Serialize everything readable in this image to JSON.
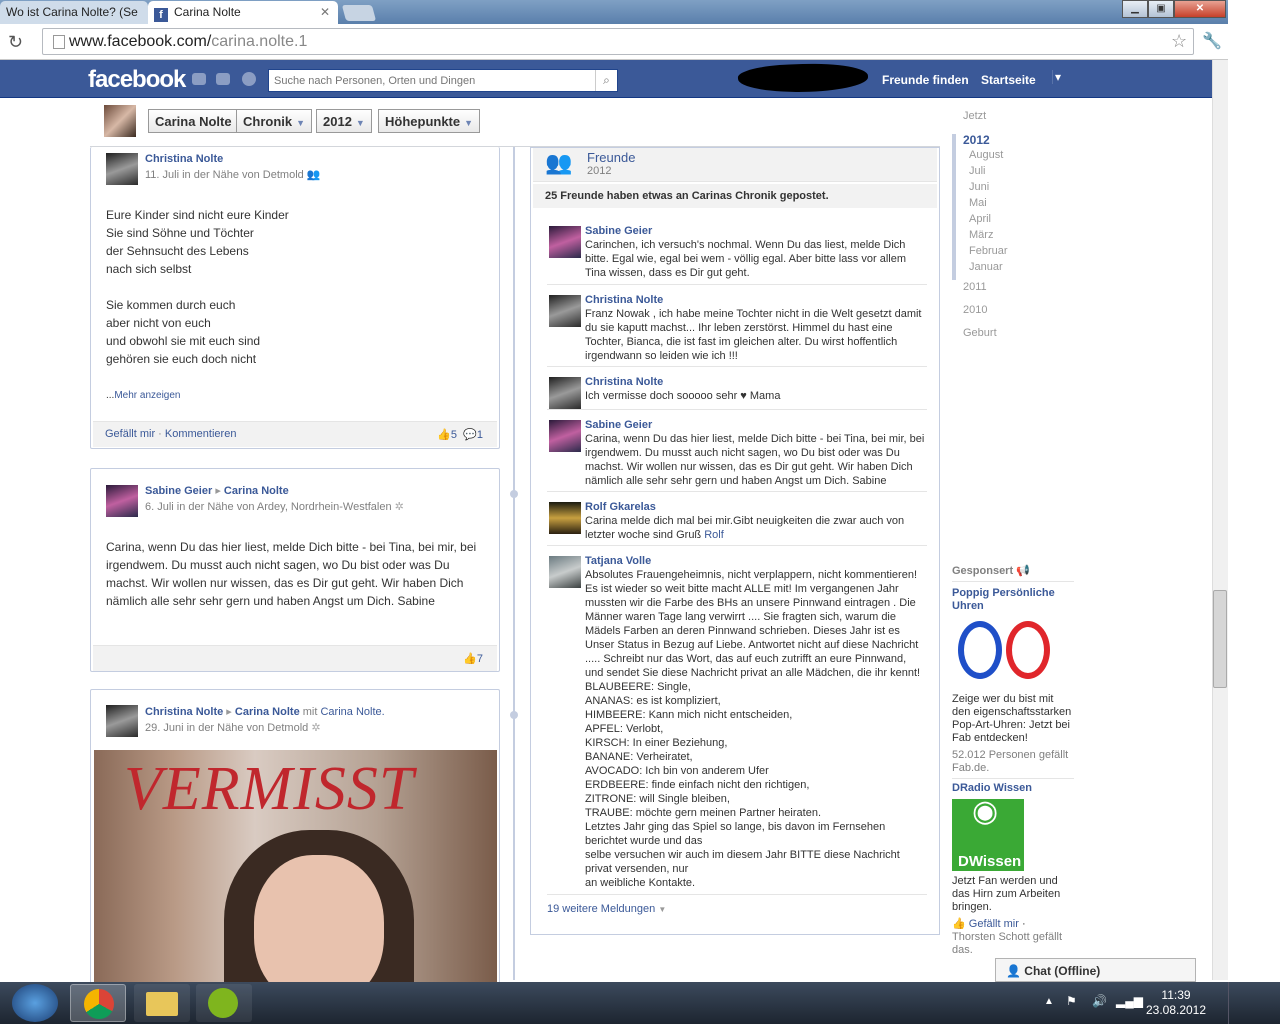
{
  "browser": {
    "tabs": [
      {
        "title": "Wo ist Carina Nolte? (Se"
      },
      {
        "title": "Carina Nolte"
      }
    ],
    "url_host": "www.facebook.com/",
    "url_path": "carina.nolte.1"
  },
  "fb_header": {
    "logo": "facebook",
    "search_placeholder": "Suche nach Personen, Orten und Dingen",
    "find_friends": "Freunde finden",
    "home": "Startseite"
  },
  "timeline_header": {
    "name": "Carina Nolte",
    "chronik": "Chronik",
    "year": "2012",
    "highlights": "Höhepunkte"
  },
  "stories": [
    {
      "author": "Christina Nolte",
      "meta": "11. Juli in der Nähe von Detmold",
      "lines": [
        "Eure Kinder sind nicht eure Kinder",
        "Sie sind Söhne und Töchter",
        "der Sehnsucht des Lebens",
        "nach sich selbst",
        "",
        "Sie kommen durch euch",
        "aber nicht von euch",
        "und obwohl sie mit euch sind",
        "gehören sie euch doch nicht"
      ],
      "more_prefix": "...",
      "more": "Mehr anzeigen",
      "like": "Gefällt mir",
      "comment": "Kommentieren",
      "likes": "5",
      "comments": "1"
    },
    {
      "author": "Sabine Geier",
      "target": "Carina Nolte",
      "meta": "6. Juli in der Nähe von Ardey, Nordrhein-Westfalen",
      "text": "Carina, wenn Du das hier liest, melde Dich bitte - bei Tina, bei mir, bei irgendwem. Du musst auch nicht sagen, wo Du bist oder was Du machst. Wir wollen nur wissen, das es Dir gut geht. Wir haben Dich nämlich alle sehr sehr gern und haben Angst um Dich. Sabine",
      "likes": "7"
    },
    {
      "author": "Christina Nolte",
      "target": "Carina Nolte",
      "with_prefix": "mit",
      "with": "Carina Nolte.",
      "meta": "29. Juni in der Nähe von Detmold",
      "image_caption": "VERMISST"
    }
  ],
  "friends_box": {
    "title": "Freunde",
    "year": "2012",
    "summary": "25 Freunde haben etwas an Carinas Chronik gepostet.",
    "posts": [
      {
        "name": "Sabine Geier",
        "text": "Carinchen, ich versuch's nochmal. Wenn Du das liest, melde Dich bitte. Egal wie, egal bei wem - völlig egal. Aber bitte lass vor allem Tina wissen, dass es Dir gut geht."
      },
      {
        "name": "Christina Nolte",
        "text": "Franz Nowak , ich habe meine Tochter nicht in die Welt gesetzt damit du sie kaputt machst... Ihr leben zerstörst. Himmel du hast eine Tochter, Bianca, die ist fast im gleichen alter. Du wirst hoffentlich irgendwann so leiden wie ich !!!"
      },
      {
        "name": "Christina Nolte",
        "text": "Ich vermisse doch sooooo sehr ♥ Mama"
      },
      {
        "name": "Sabine Geier",
        "text": "Carina, wenn Du das hier liest, melde Dich bitte - bei Tina, bei mir, bei irgendwem. Du musst auch nicht sagen, wo Du bist oder was Du machst. Wir wollen nur wissen, das es Dir gut geht. Wir haben Dich nämlich alle sehr sehr gern und haben Angst um Dich. Sabine"
      },
      {
        "name": "Rolf Gkarelas",
        "text": "Carina melde dich mal bei mir.Gibt neuigkeiten die zwar auch von letzter woche sind Gruß",
        "link": "Rolf"
      },
      {
        "name": "Tatjana Volle",
        "lines": [
          "Absolutes Frauengeheimnis, nicht verplappern, nicht kommentieren!",
          "Es ist wieder so weit bitte macht ALLE mit! Im vergangenen Jahr mussten wir die Farbe des BHs an unsere Pinnwand eintragen . Die Männer waren Tage lang verwirrt .... Sie fragten sich, warum die Mädels Farben an deren Pinnwand schrieben. Dieses Jahr ist es Unser Status in Bezug auf Liebe. Antwortet nicht auf diese Nachricht ..... Schreibt nur das Wort, das auf euch zutrifft an eure Pinnwand, und sendet Sie diese Nachricht privat an alle Mädchen, die ihr kennt!",
          "BLAUBEERE: Single,",
          "ANANAS: es ist kompliziert,",
          "HIMBEERE: Kann mich nicht entscheiden,",
          "APFEL: Verlobt,",
          "KIRSCH: In einer Beziehung,",
          "BANANE: Verheiratet,",
          "AVOCADO: Ich bin von anderem Ufer",
          "ERDBEERE: finde einfach nicht den richtigen,",
          "ZITRONE: will Single bleiben,",
          "TRAUBE: möchte gern meinen Partner heiraten.",
          "Letztes Jahr ging das Spiel so lange, bis davon im Fernsehen berichtet wurde und das",
          "selbe versuchen wir auch im diesem Jahr BITTE diese Nachricht privat versenden, nur",
          "an weibliche Kontakte."
        ]
      }
    ],
    "more": "19 weitere Meldungen"
  },
  "timeline_nav": {
    "now": "Jetzt",
    "year_current": "2012",
    "months": [
      "August",
      "Juli",
      "Juni",
      "Mai",
      "April",
      "März",
      "Februar",
      "Januar"
    ],
    "years": [
      "2011",
      "2010"
    ],
    "birth": "Geburt"
  },
  "sponsored": {
    "heading": "Gesponsert",
    "ad1_title": "Poppig Persönliche Uhren",
    "ad1_text": "Zeige wer du bist mit den eigenschaftsstarken Pop-Art-Uhren: Jetzt bei Fab entdecken!",
    "ad1_social": "52.012 Personen gefällt Fab.de.",
    "ad2_title": "DRadio Wissen",
    "ad2_logo": "DWissen",
    "ad2_text": "Jetzt Fan werden und das Hirn zum Arbeiten bringen.",
    "ad2_like": "Gefällt mir",
    "ad2_social": "Thorsten Schott gefällt das."
  },
  "chat": "Chat (Offline)",
  "taskbar": {
    "time": "11:39",
    "date": "23.08.2012"
  }
}
